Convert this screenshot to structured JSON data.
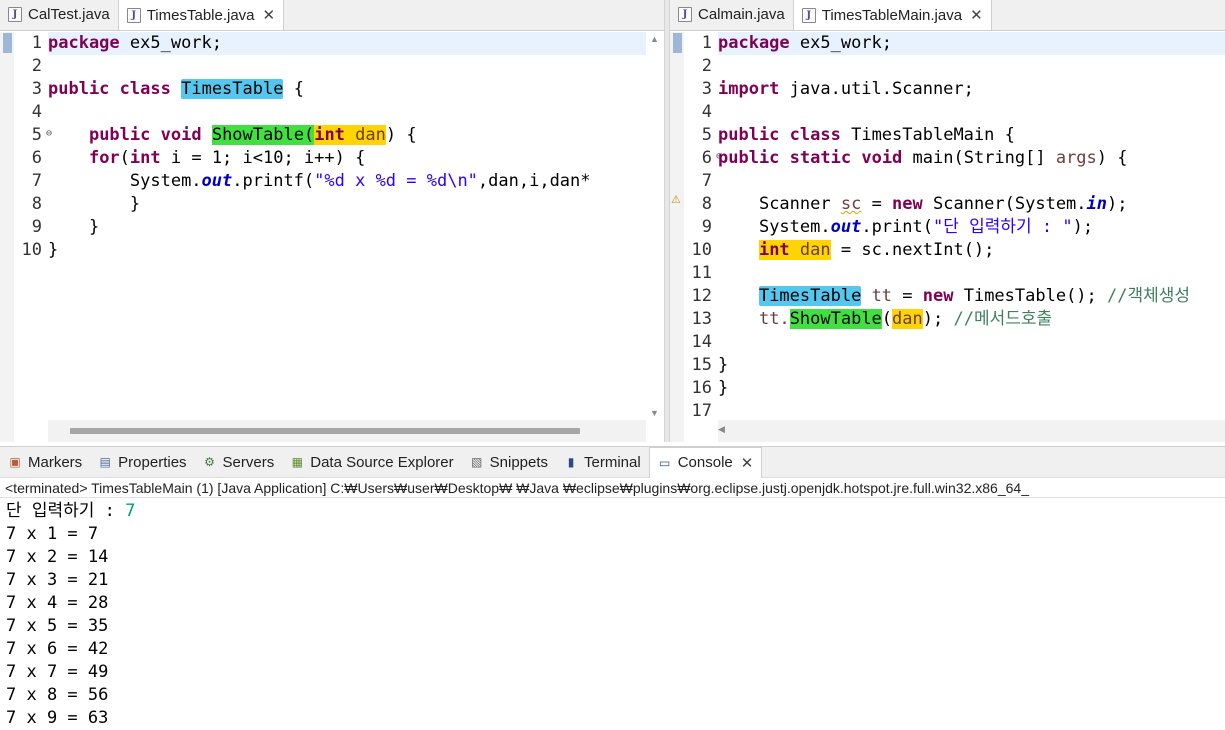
{
  "left_editor": {
    "tabs": [
      {
        "label": "CalTest.java",
        "active": false
      },
      {
        "label": "TimesTable.java",
        "active": true
      }
    ],
    "line_numbers": [
      "1",
      "2",
      "3",
      "4",
      "5",
      "6",
      "7",
      "8",
      "9",
      "10"
    ],
    "code": {
      "l1_kw": "package",
      "l1_rest": " ex5_work;",
      "l3_kw1": "public",
      "l3_kw2": "class",
      "l3_name": "TimesTable",
      "l3_rest": " {",
      "l5_kw1": "public",
      "l5_kw2": "void",
      "l5_method": "ShowTable",
      "l5_paren": "(",
      "l5_kw3": "int",
      "l5_param": "dan",
      "l5_rest": ") {",
      "l6_kw1": "for",
      "l6_a": "(",
      "l6_kw2": "int",
      "l6_b": " i = 1; i<10; i++) {",
      "l7_a": "System.",
      "l7_out": "out",
      "l7_b": ".printf(",
      "l7_str": "\"%d x %d = %d\\n\"",
      "l7_c": ",dan,i,dan*",
      "l8": "}",
      "l9": "}",
      "l10": "}"
    }
  },
  "right_editor": {
    "tabs": [
      {
        "label": "Calmain.java",
        "active": false
      },
      {
        "label": "TimesTableMain.java",
        "active": true
      }
    ],
    "line_numbers": [
      "1",
      "2",
      "3",
      "4",
      "5",
      "6",
      "7",
      "8",
      "9",
      "10",
      "11",
      "12",
      "13",
      "14",
      "15",
      "16",
      "17"
    ],
    "code": {
      "l1_kw": "package",
      "l1_rest": " ex5_work;",
      "l3_kw": "import",
      "l3_rest": " java.util.Scanner;",
      "l5_kw1": "public",
      "l5_kw2": "class",
      "l5_rest": " TimesTableMain {",
      "l6_kw1": "public",
      "l6_kw2": "static",
      "l6_kw3": "void",
      "l6_rest": " main(String[] ",
      "l6_args": "args",
      "l6_end": ") {",
      "l8_a": "Scanner ",
      "l8_sc": "sc",
      "l8_b": " = ",
      "l8_kw": "new",
      "l8_c": " Scanner(System.",
      "l8_in": "in",
      "l8_d": ");",
      "l9_a": "System.",
      "l9_out": "out",
      "l9_b": ".print(",
      "l9_str": "\"단 입력하기 : \"",
      "l9_c": ");",
      "l10_kw": "int",
      "l10_dan": "dan",
      "l10_rest": " = sc.nextInt();",
      "l12_cls": "TimesTable",
      "l12_a": " ",
      "l12_tt": "tt",
      "l12_b": " = ",
      "l12_kw": "new",
      "l12_c": " TimesTable(); ",
      "l12_cmt": "//객체생성",
      "l13_a": "tt.",
      "l13_method": "ShowTable",
      "l13_b": "(",
      "l13_dan": "dan",
      "l13_c": "); ",
      "l13_cmt": "//메서드호출",
      "l15": "}",
      "l16": "}"
    }
  },
  "bottom_panel": {
    "tabs": [
      {
        "label": "Markers",
        "icon": "markers-icon"
      },
      {
        "label": "Properties",
        "icon": "properties-icon"
      },
      {
        "label": "Servers",
        "icon": "servers-icon"
      },
      {
        "label": "Data Source Explorer",
        "icon": "data-source-icon"
      },
      {
        "label": "Snippets",
        "icon": "snippets-icon"
      },
      {
        "label": "Terminal",
        "icon": "terminal-icon"
      },
      {
        "label": "Console",
        "icon": "console-icon",
        "active": true
      }
    ],
    "status": "<terminated> TimesTableMain (1) [Java Application] C:₩Users₩user₩Desktop₩             ₩Java                              ₩eclipse₩plugins₩org.eclipse.justj.openjdk.hotspot.jre.full.win32.x86_64_",
    "console_prompt": "단 입력하기 : ",
    "console_input": "7",
    "console_lines": [
      "7 x 1 = 7",
      "7 x 2 = 14",
      "7 x 3 = 21",
      "7 x 4 = 28",
      "7 x 5 = 35",
      "7 x 6 = 42",
      "7 x 7 = 49",
      "7 x 8 = 56",
      "7 x 9 = 63"
    ]
  }
}
